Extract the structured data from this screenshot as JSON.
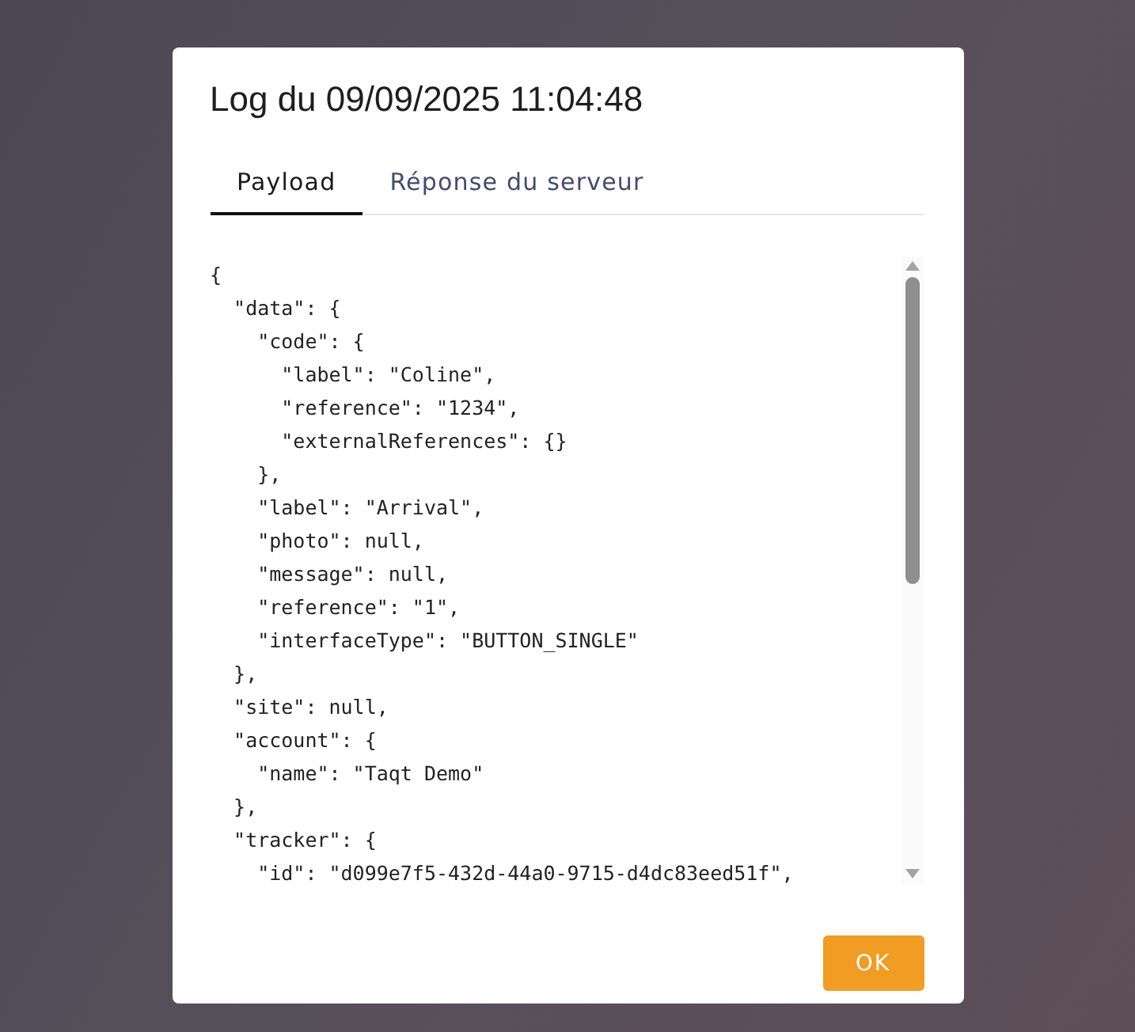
{
  "dialog": {
    "title": "Log du 09/09/2025 11:04:48",
    "tabs": [
      {
        "label": "Payload",
        "selected": true
      },
      {
        "label": "Réponse du serveur",
        "selected": false
      }
    ],
    "code_lines": [
      "{",
      "  \"data\": {",
      "    \"code\": {",
      "      \"label\": \"Coline\",",
      "      \"reference\": \"1234\",",
      "      \"externalReferences\": {}",
      "    },",
      "    \"label\": \"Arrival\",",
      "    \"photo\": null,",
      "    \"message\": null,",
      "    \"reference\": \"1\",",
      "    \"interfaceType\": \"BUTTON_SINGLE\"",
      "  },",
      "  \"site\": null,",
      "  \"account\": {",
      "    \"name\": \"Taqt Demo\"",
      "  },",
      "  \"tracker\": {",
      "    \"id\": \"d099e7f5-432d-44a0-9715-d4dc83eed51f\","
    ],
    "buttons": [
      "OK"
    ]
  }
}
